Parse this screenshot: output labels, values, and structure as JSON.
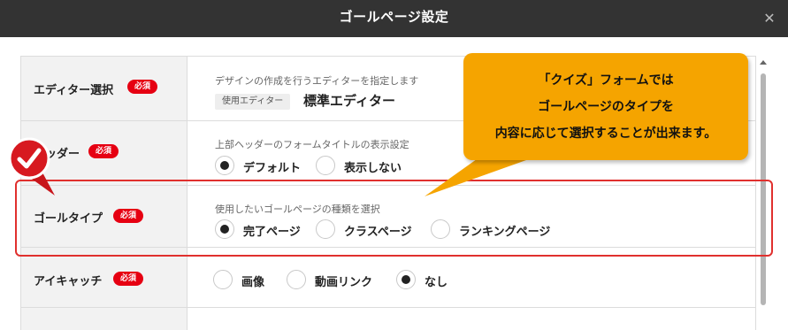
{
  "dialog": {
    "title": "ゴールページ設定",
    "close_glyph": "✕"
  },
  "required_badge": "必須",
  "rows": {
    "editor": {
      "label": "エディター選択",
      "description": "デザインの作成を行うエディターを指定します",
      "tag": "使用エディター",
      "value": "標準エディター"
    },
    "header": {
      "label": "ヘッダー",
      "description": "上部ヘッダーのフォームタイトルの表示設定",
      "options": [
        {
          "label": "デフォルト",
          "selected": true
        },
        {
          "label": "表示しない",
          "selected": false
        }
      ]
    },
    "goal_type": {
      "label": "ゴールタイプ",
      "description": "使用したいゴールページの種類を選択",
      "options": [
        {
          "label": "完了ページ",
          "selected": true
        },
        {
          "label": "クラスページ",
          "selected": false
        },
        {
          "label": "ランキングページ",
          "selected": false
        }
      ]
    },
    "eyecatch": {
      "label": "アイキャッチ",
      "options": [
        {
          "label": "画像",
          "selected": false
        },
        {
          "label": "動画リンク",
          "selected": false
        },
        {
          "label": "なし",
          "selected": true
        }
      ]
    }
  },
  "callout": {
    "lines": [
      "「クイズ」フォームでは",
      "ゴールページのタイプを",
      "内容に応じて選択することが出来ます。"
    ],
    "color": "#f5a400"
  },
  "annotation": {
    "highlight_color": "#e0302e",
    "badge_icon": "checkmark-icon"
  }
}
